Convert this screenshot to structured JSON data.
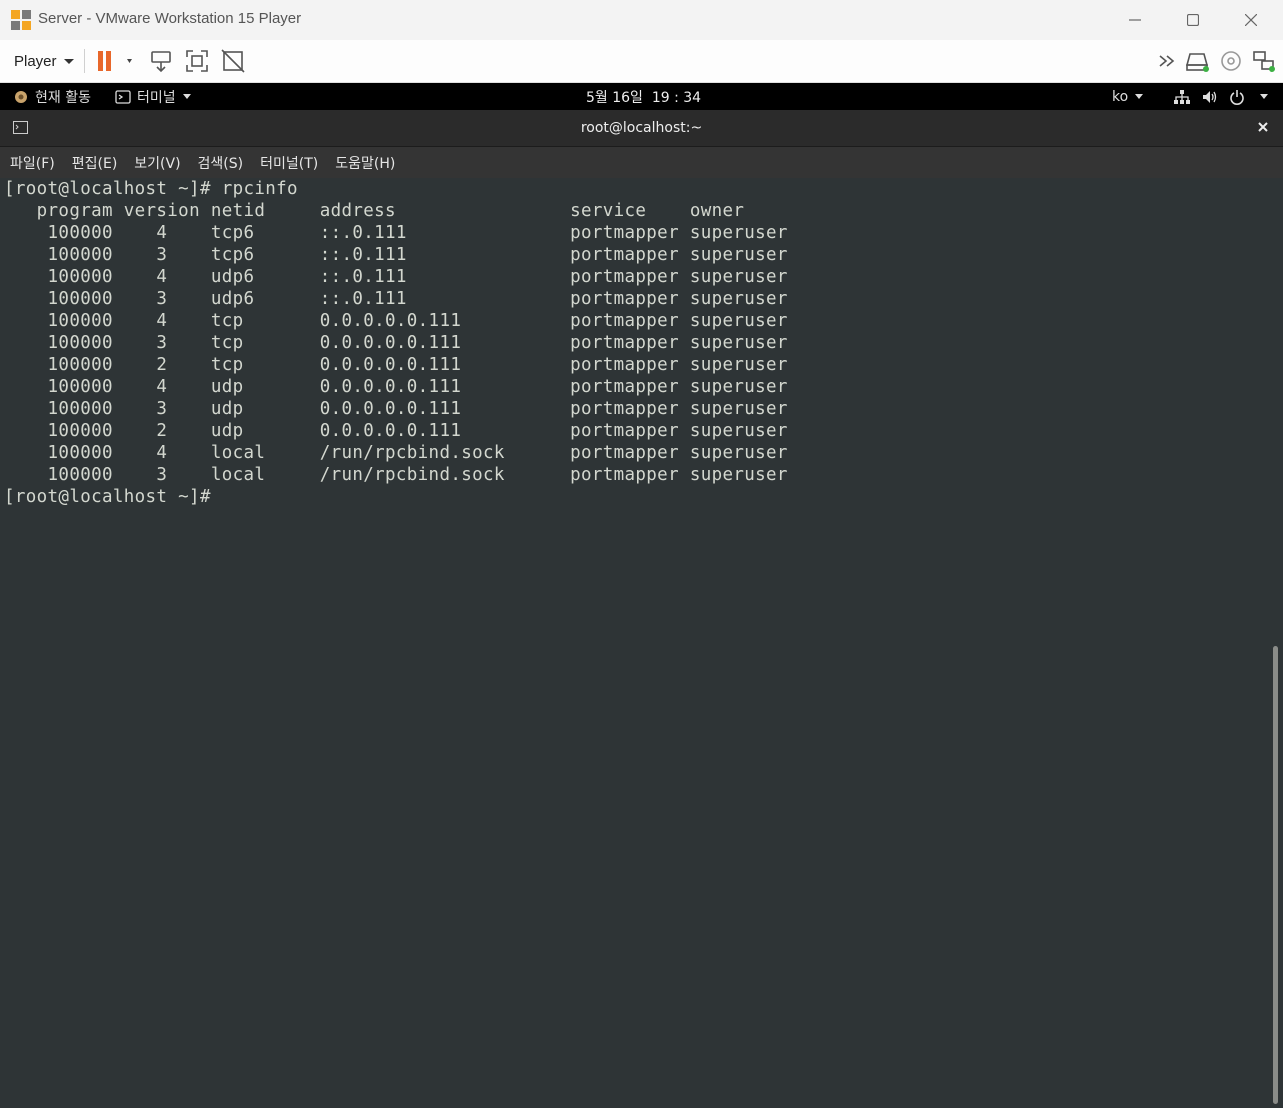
{
  "window": {
    "title": "Server - VMware Workstation 15 Player",
    "minimize_icon": "minimize-icon",
    "maximize_icon": "maximize-icon",
    "close_icon": "close-icon"
  },
  "toolbar": {
    "player_menu_label": "Player",
    "icons": [
      "pause-icon",
      "send-ctrl-alt-del-icon",
      "fullscreen-icon",
      "unity-icon",
      "more-icon",
      "hard-disk-icon",
      "cd-icon",
      "network-adapter-icon"
    ],
    "pause_color": "#e8672a"
  },
  "gnome": {
    "activities_label": "현재 활동",
    "app_menu_label": "터미널",
    "clock": "5월 16일  19 : 34",
    "input_method": "ko"
  },
  "terminal": {
    "title": "root@localhost:~",
    "menus": [
      "파일(F)",
      "편집(E)",
      "보기(V)",
      "검색(S)",
      "터미널(T)",
      "도움말(H)"
    ],
    "prompt": "[root@localhost ~]#",
    "command": "rpcinfo",
    "table": {
      "headers": [
        "program",
        "version",
        "netid",
        "address",
        "service",
        "owner"
      ],
      "rows": [
        [
          "100000",
          "4",
          "tcp6",
          "::.0.111",
          "portmapper",
          "superuser"
        ],
        [
          "100000",
          "3",
          "tcp6",
          "::.0.111",
          "portmapper",
          "superuser"
        ],
        [
          "100000",
          "4",
          "udp6",
          "::.0.111",
          "portmapper",
          "superuser"
        ],
        [
          "100000",
          "3",
          "udp6",
          "::.0.111",
          "portmapper",
          "superuser"
        ],
        [
          "100000",
          "4",
          "tcp",
          "0.0.0.0.0.111",
          "portmapper",
          "superuser"
        ],
        [
          "100000",
          "3",
          "tcp",
          "0.0.0.0.0.111",
          "portmapper",
          "superuser"
        ],
        [
          "100000",
          "2",
          "tcp",
          "0.0.0.0.0.111",
          "portmapper",
          "superuser"
        ],
        [
          "100000",
          "4",
          "udp",
          "0.0.0.0.0.111",
          "portmapper",
          "superuser"
        ],
        [
          "100000",
          "3",
          "udp",
          "0.0.0.0.0.111",
          "portmapper",
          "superuser"
        ],
        [
          "100000",
          "2",
          "udp",
          "0.0.0.0.0.111",
          "portmapper",
          "superuser"
        ],
        [
          "100000",
          "4",
          "local",
          "/run/rpcbind.sock",
          "portmapper",
          "superuser"
        ],
        [
          "100000",
          "3",
          "local",
          "/run/rpcbind.sock",
          "portmapper",
          "superuser"
        ]
      ]
    },
    "colors": {
      "background": "#2e3436",
      "foreground": "#d3d7cf"
    }
  }
}
